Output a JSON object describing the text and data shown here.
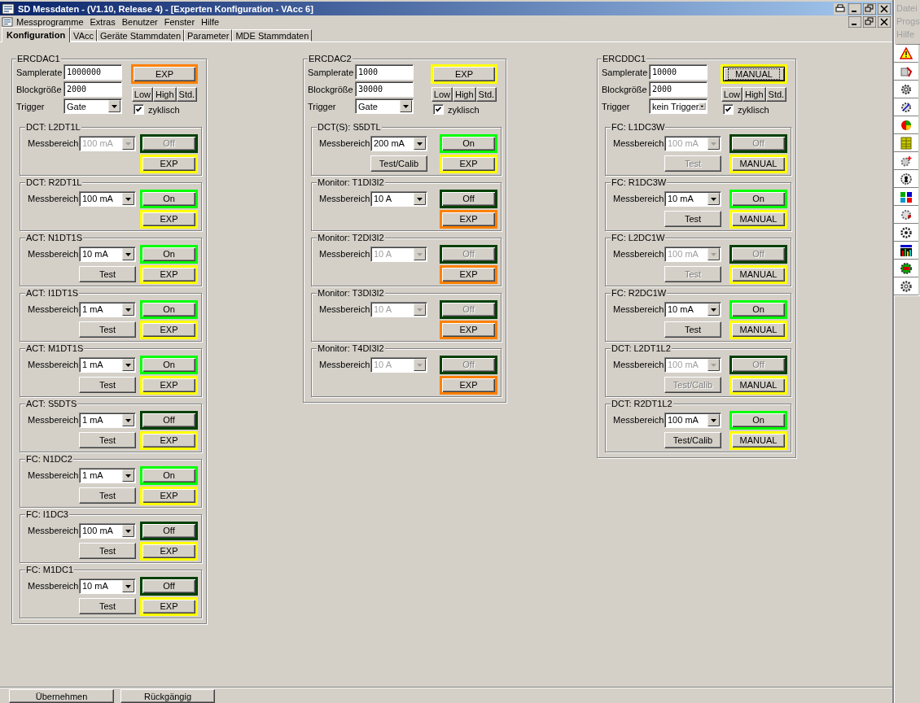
{
  "window": {
    "title": "SD Messdaten -  (V1.10, Release 4) - [Experten Konfiguration - VAcc 6]"
  },
  "menu": [
    "Messprogramme",
    "Extras",
    "Benutzer",
    "Fenster",
    "Hilfe"
  ],
  "side_menu": [
    "Datei",
    "Progs",
    "Hilfe"
  ],
  "tabs": [
    {
      "label": "Konfiguration",
      "selected": true
    },
    {
      "label": "VAcc",
      "selected": false
    },
    {
      "label": "Geräte Stammdaten",
      "selected": false
    },
    {
      "label": "Parameter",
      "selected": false
    },
    {
      "label": "MDE Stammdaten",
      "selected": false
    }
  ],
  "groups": [
    {
      "title": "ERCDAC1",
      "fields": [
        {
          "label": "Samplerate",
          "value": "1000000"
        },
        {
          "label": "Blockgröße",
          "value": "2000"
        }
      ],
      "trigger": {
        "label": "Trigger",
        "value": "Gate"
      },
      "mode_button": {
        "label": "EXP",
        "color": "#ff8000",
        "focused": false
      },
      "presets": [
        "Low",
        "High",
        "Std."
      ],
      "cyclic": {
        "label": "zyklisch",
        "checked": true
      },
      "channels": [
        {
          "title": "DCT: L2DT1L",
          "range_label": "Messbereich",
          "range": "100 mA",
          "disabled": true,
          "power": {
            "label": "Off",
            "color": "#004000"
          },
          "mode": {
            "label": "EXP",
            "color": "#ffff00"
          }
        },
        {
          "title": "DCT: R2DT1L",
          "range_label": "Messbereich",
          "range": "100 mA",
          "disabled": false,
          "power": {
            "label": "On",
            "color": "#00ff00"
          },
          "mode": {
            "label": "EXP",
            "color": "#ffff00"
          }
        },
        {
          "title": "ACT: N1DT1S",
          "range_label": "Messbereich",
          "range": "10 mA",
          "disabled": false,
          "power": {
            "label": "On",
            "color": "#00ff00"
          },
          "test": "Test",
          "mode": {
            "label": "EXP",
            "color": "#ffff00"
          }
        },
        {
          "title": "ACT: I1DT1S",
          "range_label": "Messbereich",
          "range": "1 mA",
          "disabled": false,
          "power": {
            "label": "On",
            "color": "#00ff00"
          },
          "test": "Test",
          "mode": {
            "label": "EXP",
            "color": "#ffff00"
          }
        },
        {
          "title": "ACT: M1DT1S",
          "range_label": "Messbereich",
          "range": "1 mA",
          "disabled": false,
          "power": {
            "label": "On",
            "color": "#00ff00"
          },
          "test": "Test",
          "mode": {
            "label": "EXP",
            "color": "#ffff00"
          }
        },
        {
          "title": "ACT: S5DTS",
          "range_label": "Messbereich",
          "range": "1 mA",
          "disabled": false,
          "power": {
            "label": "Off",
            "color": "#004000"
          },
          "test": "Test",
          "mode": {
            "label": "EXP",
            "color": "#ffff00"
          }
        },
        {
          "title": "FC: N1DC2",
          "range_label": "Messbereich",
          "range": "1 mA",
          "disabled": false,
          "power": {
            "label": "On",
            "color": "#00ff00"
          },
          "test": "Test",
          "mode": {
            "label": "EXP",
            "color": "#ffff00"
          }
        },
        {
          "title": "FC: I1DC3",
          "range_label": "Messbereich",
          "range": "100 mA",
          "disabled": false,
          "power": {
            "label": "Off",
            "color": "#004000"
          },
          "test": "Test",
          "mode": {
            "label": "EXP",
            "color": "#ffff00"
          }
        },
        {
          "title": "FC: M1DC1",
          "range_label": "Messbereich",
          "range": "10 mA",
          "disabled": false,
          "power": {
            "label": "Off",
            "color": "#004000"
          },
          "test": "Test",
          "mode": {
            "label": "EXP",
            "color": "#ffff00"
          }
        }
      ]
    },
    {
      "title": "ERCDAC2",
      "fields": [
        {
          "label": "Samplerate",
          "value": "1000"
        },
        {
          "label": "Blockgröße",
          "value": "30000"
        }
      ],
      "trigger": {
        "label": "Trigger",
        "value": "Gate"
      },
      "mode_button": {
        "label": "EXP",
        "color": "#ffff00",
        "focused": false
      },
      "presets": [
        "Low",
        "High",
        "Std."
      ],
      "cyclic": {
        "label": "zyklisch",
        "checked": true
      },
      "channels": [
        {
          "title": "DCT(S): S5DTL",
          "range_label": "Messbereich",
          "range": "200 mA",
          "disabled": false,
          "power": {
            "label": "On",
            "color": "#00ff00"
          },
          "test": "Test/Calib",
          "mode": {
            "label": "EXP",
            "color": "#ffff00"
          }
        },
        {
          "title": "Monitor: T1DI3I2",
          "range_label": "Messbereich",
          "range": "10 A",
          "disabled": false,
          "power": {
            "label": "Off",
            "color": "#004000"
          },
          "mode": {
            "label": "EXP",
            "color": "#ff8000"
          }
        },
        {
          "title": "Monitor: T2DI3I2",
          "range_label": "Messbereich",
          "range": "10 A",
          "disabled": true,
          "power": {
            "label": "Off",
            "color": "#004000"
          },
          "mode": {
            "label": "EXP",
            "color": "#ff8000"
          }
        },
        {
          "title": "Monitor: T3DI3I2",
          "range_label": "Messbereich",
          "range": "10 A",
          "disabled": true,
          "power": {
            "label": "Off",
            "color": "#004000"
          },
          "mode": {
            "label": "EXP",
            "color": "#ff8000"
          }
        },
        {
          "title": "Monitor: T4DI3I2",
          "range_label": "Messbereich",
          "range": "10 A",
          "disabled": true,
          "power": {
            "label": "Off",
            "color": "#004000"
          },
          "mode": {
            "label": "EXP",
            "color": "#ff8000"
          }
        }
      ]
    },
    {
      "title": "ERCDDC1",
      "fields": [
        {
          "label": "Samplerate",
          "value": "10000"
        },
        {
          "label": "Blockgröße",
          "value": "2000"
        }
      ],
      "trigger": {
        "label": "Trigger",
        "value": "kein Trigger"
      },
      "mode_button": {
        "label": "MANUAL",
        "color": "#ffff00",
        "focused": true
      },
      "presets": [
        "Low",
        "High",
        "Std."
      ],
      "cyclic": {
        "label": "zyklisch",
        "checked": true
      },
      "channels": [
        {
          "title": "FC: L1DC3W",
          "range_label": "Messbereich",
          "range": "100 mA",
          "disabled": true,
          "power": {
            "label": "Off",
            "color": "#004000"
          },
          "test": "Test",
          "mode": {
            "label": "MANUAL",
            "color": "#ffff00"
          }
        },
        {
          "title": "FC: R1DC3W",
          "range_label": "Messbereich",
          "range": "10 mA",
          "disabled": false,
          "power": {
            "label": "On",
            "color": "#00ff00"
          },
          "test": "Test",
          "mode": {
            "label": "MANUAL",
            "color": "#ffff00"
          }
        },
        {
          "title": "FC: L2DC1W",
          "range_label": "Messbereich",
          "range": "100 mA",
          "disabled": true,
          "power": {
            "label": "Off",
            "color": "#004000"
          },
          "test": "Test",
          "mode": {
            "label": "MANUAL",
            "color": "#ffff00"
          }
        },
        {
          "title": "FC: R2DC1W",
          "range_label": "Messbereich",
          "range": "10 mA",
          "disabled": false,
          "power": {
            "label": "On",
            "color": "#00ff00"
          },
          "test": "Test",
          "mode": {
            "label": "MANUAL",
            "color": "#ffff00"
          }
        },
        {
          "title": "DCT: L2DT1L2",
          "range_label": "Messbereich",
          "range": "100 mA",
          "disabled": true,
          "power": {
            "label": "Off",
            "color": "#004000"
          },
          "test": "Test/Calib",
          "mode": {
            "label": "MANUAL",
            "color": "#ffff00"
          }
        },
        {
          "title": "DCT: R2DT1L2",
          "range_label": "Messbereich",
          "range": "100 mA",
          "disabled": false,
          "power": {
            "label": "On",
            "color": "#00ff00"
          },
          "test": "Test/Calib",
          "mode": {
            "label": "MANUAL",
            "color": "#ffff00"
          }
        }
      ]
    }
  ],
  "buttons": [
    "Übernehmen",
    "Rückgängig"
  ]
}
